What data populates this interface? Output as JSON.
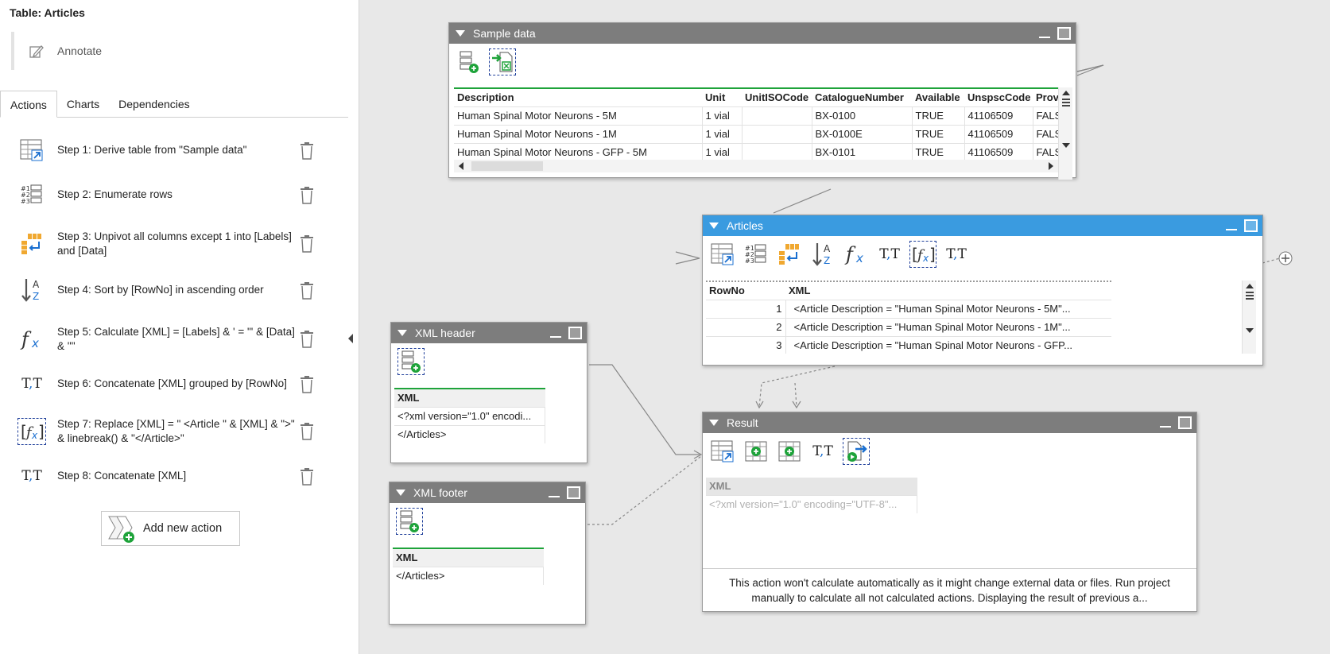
{
  "panel": {
    "title": "Table: Articles",
    "annotate_label": "Annotate",
    "tabs": [
      {
        "label": "Actions",
        "active": true
      },
      {
        "label": "Charts",
        "active": false
      },
      {
        "label": "Dependencies",
        "active": false
      }
    ],
    "steps": [
      {
        "icon": "derive-table-icon",
        "label": "Step 1: Derive table from \"Sample data\""
      },
      {
        "icon": "enumerate-rows-icon",
        "label": "Step 2: Enumerate rows"
      },
      {
        "icon": "unpivot-icon",
        "label": "Step 3: Unpivot all columns except 1 into [Labels] and [Data]"
      },
      {
        "icon": "sort-az-icon",
        "label": "Step 4: Sort by [RowNo] in ascending order"
      },
      {
        "icon": "function-icon",
        "label": "Step 5: Calculate [XML] = [Labels] & ' = \"' & [Data] & '\"'"
      },
      {
        "icon": "concatenate-icon",
        "label": "Step 6: Concatenate [XML] grouped by [RowNo]"
      },
      {
        "icon": "replace-function-icon",
        "label": "Step 7: Replace [XML] = \"  <Article \" & [XML] & \">\" & linebreak() & \"</Article>\""
      },
      {
        "icon": "concatenate-icon",
        "label": "Step 8: Concatenate [XML]"
      }
    ],
    "add_action_label": "Add new action"
  },
  "nodes": {
    "sample": {
      "title": "Sample data",
      "columns": [
        "Description",
        "Unit",
        "UnitISOCode",
        "CatalogueNumber",
        "Available",
        "UnspscCode",
        "Prov"
      ],
      "rows": [
        [
          "Human Spinal Motor Neurons - 5M",
          "1 vial",
          "",
          "BX-0100",
          "TRUE",
          "41106509",
          "FALS"
        ],
        [
          "Human Spinal Motor Neurons - 1M",
          "1 vial",
          "",
          "BX-0100E",
          "TRUE",
          "41106509",
          "FALS"
        ],
        [
          "Human Spinal Motor Neurons - GFP - 5M",
          "1 vial",
          "",
          "BX-0101",
          "TRUE",
          "41106509",
          "FALS"
        ]
      ]
    },
    "articles": {
      "title": "Articles",
      "columns": [
        "RowNo",
        "XML"
      ],
      "rows": [
        [
          "1",
          "<Article Description = \"Human Spinal Motor Neurons - 5M\"..."
        ],
        [
          "2",
          "<Article Description = \"Human Spinal Motor Neurons - 1M\"..."
        ],
        [
          "3",
          "<Article Description = \"Human Spinal Motor Neurons - GFP..."
        ]
      ]
    },
    "xml_header": {
      "title": "XML header",
      "column": "XML",
      "rows": [
        "<?xml version=\"1.0\" encodi...",
        "</Articles>"
      ]
    },
    "xml_footer": {
      "title": "XML footer",
      "column": "XML",
      "rows": [
        "</Articles>"
      ]
    },
    "result": {
      "title": "Result",
      "column": "XML",
      "rows": [
        "<?xml version=\"1.0\" encoding=\"UTF-8\"..."
      ],
      "notice": "This action won't calculate automatically as it might change external data or files. Run project manually to calculate all not calculated actions. Displaying the result of previous a..."
    }
  },
  "colors": {
    "accent_green": "#1ea33a",
    "header_gray": "#7d7d7d",
    "header_blue": "#3a9be0",
    "icon_blue": "#1a6fd0"
  }
}
